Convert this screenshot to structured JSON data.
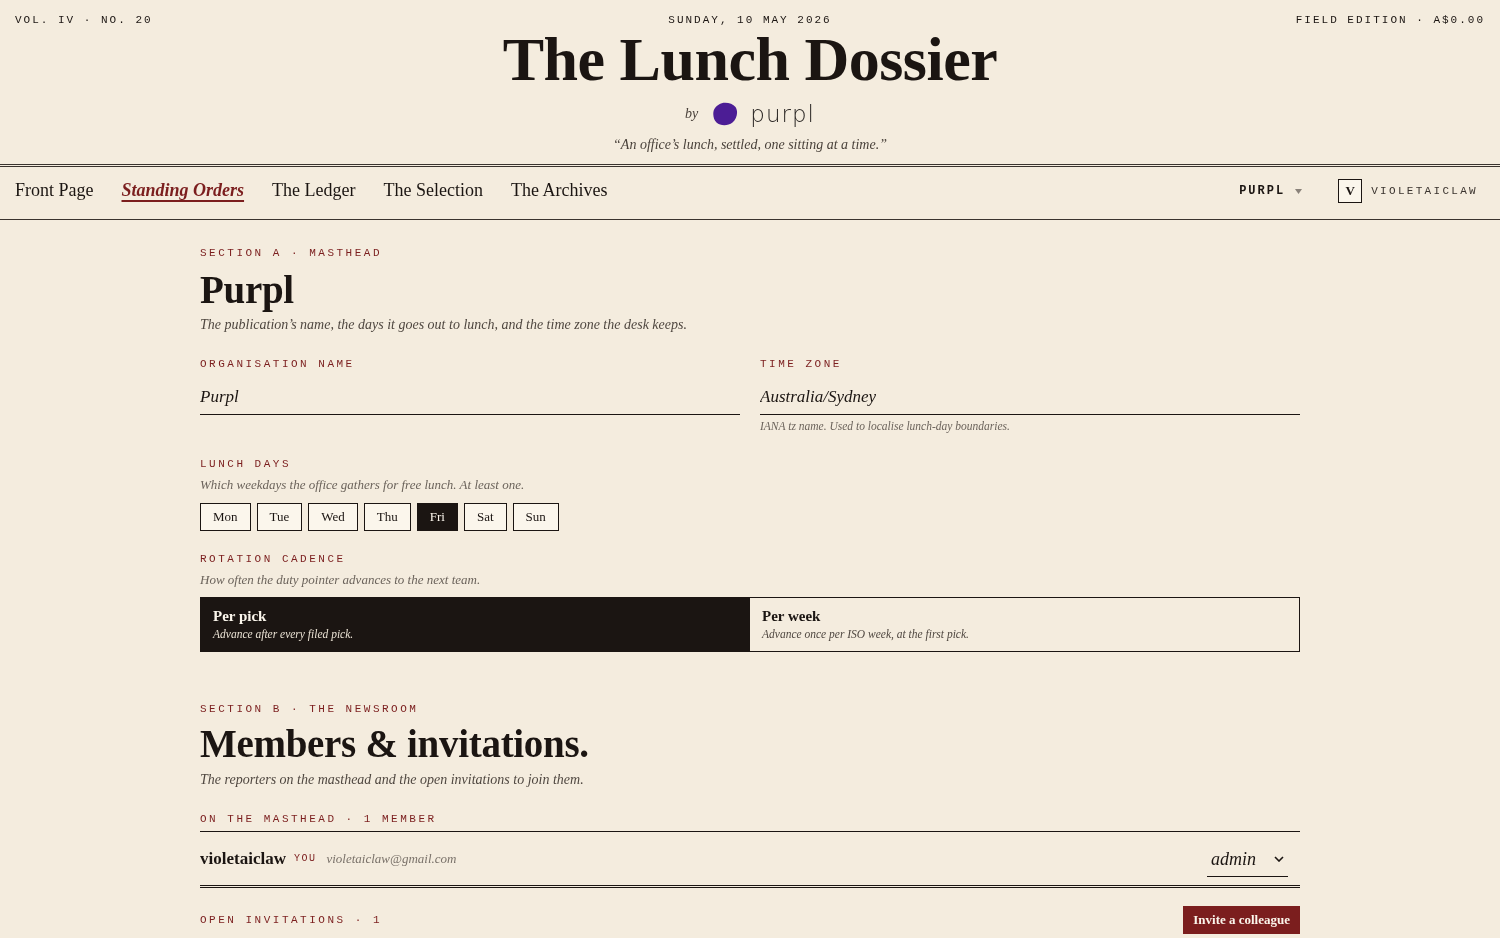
{
  "masthead": {
    "volume": "VOL. IV · NO. 20",
    "date": "SUNDAY, 10 MAY 2026",
    "edition": "FIELD EDITION · A$0.00",
    "title": "The Lunch Dossier",
    "byline": "by",
    "brand": "purpl",
    "motto": "“An office’s lunch, settled, one sitting at a time.”"
  },
  "nav": {
    "items": [
      {
        "label": "Front Page",
        "selected": false
      },
      {
        "label": "Standing Orders",
        "selected": true
      },
      {
        "label": "The Ledger",
        "selected": false
      },
      {
        "label": "The Selection",
        "selected": false
      },
      {
        "label": "The Archives",
        "selected": false
      }
    ],
    "org_switcher": "PURPL",
    "user": {
      "initial": "V",
      "name": "VIOLETAICLAW"
    }
  },
  "organisation": {
    "kicker": "SECTION A · MASTHEAD",
    "heading": "Purpl",
    "description": "The publication’s name, the days it goes out to lunch, and the time zone the desk keeps.",
    "fields": [
      {
        "label": "ORGANISATION NAME",
        "value": "Purpl"
      },
      {
        "label": "TIME ZONE",
        "value": "Australia/Sydney",
        "hint": "IANA tz name. Used to localise lunch-day boundaries."
      }
    ],
    "lunch_days": {
      "label": "LUNCH DAYS",
      "description": "Which weekdays the office gathers for free lunch. At least one.",
      "days": [
        {
          "label": "Mon",
          "selected": false
        },
        {
          "label": "Tue",
          "selected": false
        },
        {
          "label": "Wed",
          "selected": false
        },
        {
          "label": "Thu",
          "selected": false
        },
        {
          "label": "Fri",
          "selected": true
        },
        {
          "label": "Sat",
          "selected": false
        },
        {
          "label": "Sun",
          "selected": false
        }
      ]
    },
    "rotation_cadence": {
      "label": "ROTATION CADENCE",
      "description": "How often the duty pointer advances to the next team.",
      "options": [
        {
          "title": "Per pick",
          "description": "Advance after every filed pick.",
          "selected": true
        },
        {
          "title": "Per week",
          "description": "Advance once per ISO week, at the first pick.",
          "selected": false
        }
      ]
    }
  },
  "members": {
    "kicker": "SECTION B · THE NEWSROOM",
    "heading": "Members & invitations.",
    "description": "The reporters on the masthead and the open invitations to join them.",
    "masthead_label": "ON THE MASTHEAD · 1 MEMBER",
    "rows": [
      {
        "name": "violetaiclaw",
        "tag": "YOU",
        "email": "violetaiclaw@gmail.com",
        "role": "admin"
      }
    ],
    "invitations_label": "OPEN INVITATIONS · 1",
    "invite_button": "Invite a colleague"
  }
}
